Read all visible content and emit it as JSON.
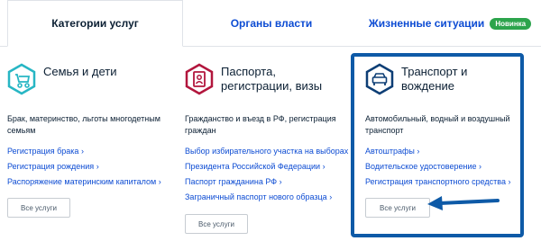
{
  "tabs": [
    {
      "label": "Категории услуг"
    },
    {
      "label": "Органы власти"
    },
    {
      "label": "Жизненные ситуации",
      "badge": "Новинка"
    }
  ],
  "cards": [
    {
      "title": "Семья и дети",
      "icon": "stroller-icon",
      "description": "Брак, материнство, льготы многодетным семьям",
      "links": [
        "Регистрация брака",
        "Регистрация рождения",
        "Распоряжение материнским капиталом"
      ],
      "button": "Все услуги"
    },
    {
      "title": "Паспорта, регистрации, визы",
      "icon": "passport-icon",
      "description": "Гражданство и въезд в РФ, регистрация граждан",
      "links": [
        "Выбор избирательного участка на выборах",
        "Президента Российской Федерации",
        "Паспорт гражданина РФ",
        "Заграничный паспорт нового образца"
      ],
      "button": "Все услуги"
    },
    {
      "title": "Транспорт и вождение",
      "icon": "car-icon",
      "description": "Автомобильный, водный и воздушный транспорт",
      "links": [
        "Автоштрафы",
        "Водительское удостоверение",
        "Регистрация транспортного средства"
      ],
      "button": "Все услуги"
    }
  ],
  "link_suffix": "›",
  "colors": {
    "accent": "#0d4cd3",
    "highlight": "#0e5aa7",
    "badge": "#2ca44c",
    "icon_family": "#27b6c4",
    "icon_passport": "#b2163d",
    "icon_car": "#0d3e75"
  }
}
